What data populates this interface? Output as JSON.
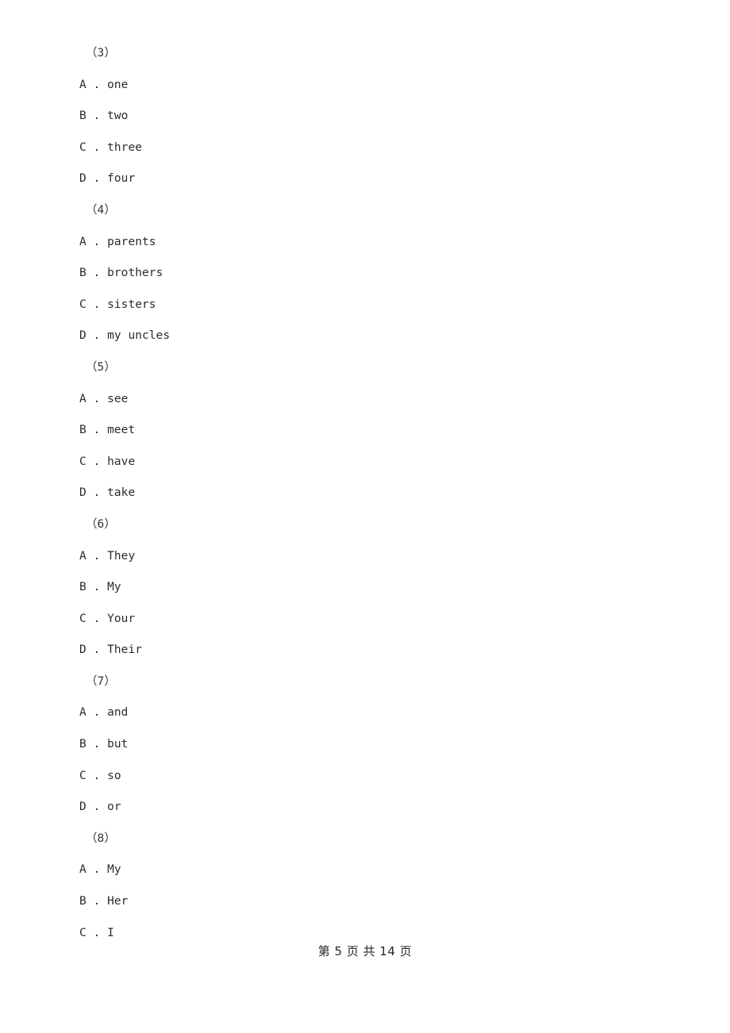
{
  "document": {
    "page_background": "#ffffff",
    "text_color": "#2a2a2a"
  },
  "questions": [
    {
      "number_label": "（3）",
      "options": [
        {
          "letter": "A",
          "separator": " . ",
          "text": "one"
        },
        {
          "letter": "B",
          "separator": " . ",
          "text": "two"
        },
        {
          "letter": "C",
          "separator": " . ",
          "text": "three"
        },
        {
          "letter": "D",
          "separator": " . ",
          "text": "four"
        }
      ]
    },
    {
      "number_label": "（4）",
      "options": [
        {
          "letter": "A",
          "separator": " . ",
          "text": "parents"
        },
        {
          "letter": "B",
          "separator": " . ",
          "text": "brothers"
        },
        {
          "letter": "C",
          "separator": " . ",
          "text": "sisters"
        },
        {
          "letter": "D",
          "separator": " . ",
          "text": "my uncles"
        }
      ]
    },
    {
      "number_label": "（5）",
      "options": [
        {
          "letter": "A",
          "separator": " . ",
          "text": "see"
        },
        {
          "letter": "B",
          "separator": " . ",
          "text": "meet"
        },
        {
          "letter": "C",
          "separator": " . ",
          "text": "have"
        },
        {
          "letter": "D",
          "separator": " . ",
          "text": "take"
        }
      ]
    },
    {
      "number_label": "（6）",
      "options": [
        {
          "letter": "A",
          "separator": " . ",
          "text": "They"
        },
        {
          "letter": "B",
          "separator": " . ",
          "text": "My"
        },
        {
          "letter": "C",
          "separator": " . ",
          "text": "Your"
        },
        {
          "letter": "D",
          "separator": " . ",
          "text": "Their"
        }
      ]
    },
    {
      "number_label": "（7）",
      "options": [
        {
          "letter": "A",
          "separator": " . ",
          "text": "and"
        },
        {
          "letter": "B",
          "separator": " . ",
          "text": "but"
        },
        {
          "letter": "C",
          "separator": " . ",
          "text": "so"
        },
        {
          "letter": "D",
          "separator": " . ",
          "text": "or"
        }
      ]
    },
    {
      "number_label": "（8）",
      "options": [
        {
          "letter": "A",
          "separator": " . ",
          "text": "My"
        },
        {
          "letter": "B",
          "separator": " . ",
          "text": "Her"
        },
        {
          "letter": "C",
          "separator": " . ",
          "text": "I"
        }
      ]
    }
  ],
  "footer": {
    "text": "第 5 页 共 14 页",
    "current_page": "5",
    "total_pages": "14"
  }
}
